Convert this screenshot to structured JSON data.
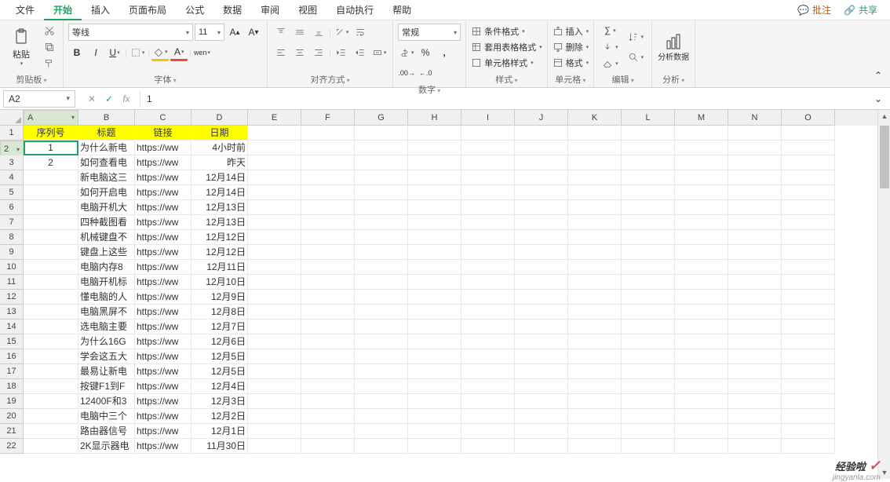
{
  "menu": {
    "items": [
      "文件",
      "开始",
      "插入",
      "页面布局",
      "公式",
      "数据",
      "审阅",
      "视图",
      "自动执行",
      "帮助"
    ],
    "active": 1,
    "comment": "批注",
    "share": "共享"
  },
  "ribbon": {
    "clipboard": {
      "paste": "粘贴",
      "label": "剪贴板"
    },
    "font": {
      "name": "等线",
      "size": "11",
      "label": "字体",
      "bold": "B",
      "italic": "I",
      "underline": "U",
      "wen": "wen"
    },
    "align": {
      "label": "对齐方式"
    },
    "number": {
      "format": "常规",
      "label": "数字",
      "percent": "%"
    },
    "styles": {
      "cond": "条件格式",
      "table": "套用表格格式",
      "cell": "单元格样式",
      "label": "样式"
    },
    "cells": {
      "insert": "插入",
      "delete": "删除",
      "format": "格式",
      "label": "单元格"
    },
    "editing": {
      "label": "编辑"
    },
    "analysis": {
      "btn": "分析数据",
      "label": "分析"
    }
  },
  "formula_bar": {
    "name": "A2",
    "value": "1",
    "fx": "fx"
  },
  "cols": [
    "A",
    "B",
    "C",
    "D",
    "E",
    "F",
    "G",
    "H",
    "I",
    "J",
    "K",
    "L",
    "M",
    "N",
    "O"
  ],
  "headers": {
    "a": "序列号",
    "b": "标题",
    "c": "链接",
    "d": "日期"
  },
  "rows": [
    {
      "n": 1
    },
    {
      "n": 2,
      "a": "1",
      "b": "为什么新电",
      "c": "https://ww",
      "d": "4小时前"
    },
    {
      "n": 3,
      "a": "2",
      "b": "如何查看电",
      "c": "https://ww",
      "d": "昨天"
    },
    {
      "n": 4,
      "b": "新电脑这三",
      "c": "https://ww",
      "d": "12月14日"
    },
    {
      "n": 5,
      "b": "如何开启电",
      "c": "https://ww",
      "d": "12月14日"
    },
    {
      "n": 6,
      "b": "电脑开机大",
      "c": "https://ww",
      "d": "12月13日"
    },
    {
      "n": 7,
      "b": "四种截图看",
      "c": "https://ww",
      "d": "12月13日"
    },
    {
      "n": 8,
      "b": "机械键盘不",
      "c": "https://ww",
      "d": "12月12日"
    },
    {
      "n": 9,
      "b": "键盘上这些",
      "c": "https://ww",
      "d": "12月12日"
    },
    {
      "n": 10,
      "b": "电脑内存8",
      "c": "https://ww",
      "d": "12月11日"
    },
    {
      "n": 11,
      "b": "电脑开机标",
      "c": "https://ww",
      "d": "12月10日"
    },
    {
      "n": 12,
      "b": "懂电脑的人",
      "c": "https://ww",
      "d": "12月9日"
    },
    {
      "n": 13,
      "b": "电脑黑屏不",
      "c": "https://ww",
      "d": "12月8日"
    },
    {
      "n": 14,
      "b": "选电脑主要",
      "c": "https://ww",
      "d": "12月7日"
    },
    {
      "n": 15,
      "b": "为什么16G",
      "c": "https://ww",
      "d": "12月6日"
    },
    {
      "n": 16,
      "b": "学会这五大",
      "c": "https://ww",
      "d": "12月5日"
    },
    {
      "n": 17,
      "b": "最易让新电",
      "c": "https://ww",
      "d": "12月5日"
    },
    {
      "n": 18,
      "b": "按键F1到F",
      "c": "https://ww",
      "d": "12月4日"
    },
    {
      "n": 19,
      "b": "12400F和3",
      "c": "https://ww",
      "d": "12月3日"
    },
    {
      "n": 20,
      "b": "电脑中三个",
      "c": "https://ww",
      "d": "12月2日"
    },
    {
      "n": 21,
      "b": "路由器信号",
      "c": "https://ww",
      "d": "12月1日"
    },
    {
      "n": 22,
      "b": "2K显示器电",
      "c": "https://ww",
      "d": "11月30日"
    }
  ],
  "watermark": {
    "cn": "经验啦",
    "en": "jingyanla.com"
  }
}
